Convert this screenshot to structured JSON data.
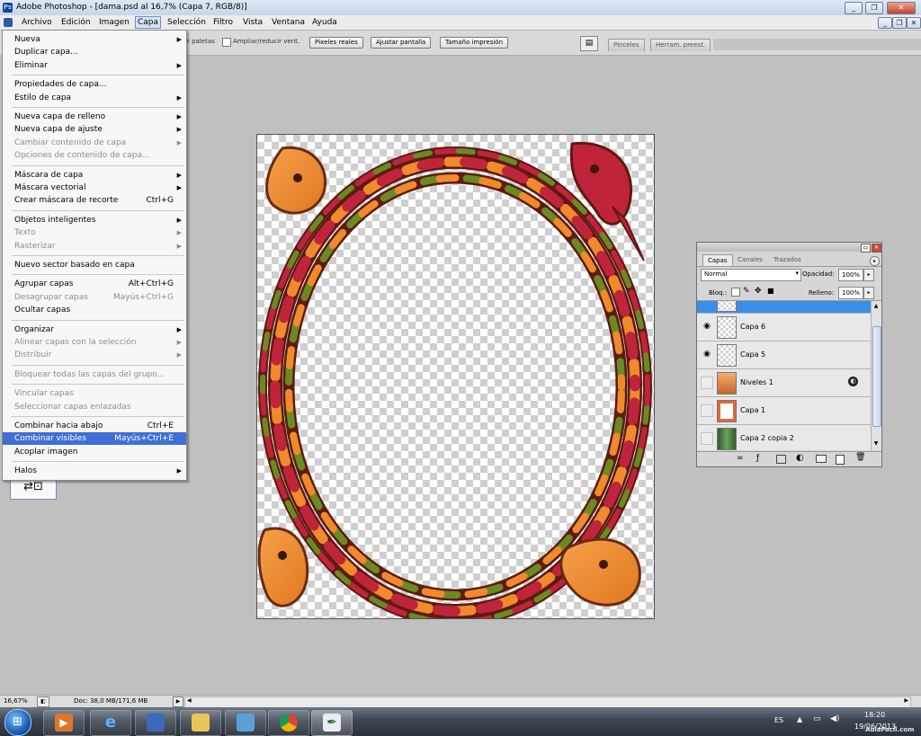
{
  "window": {
    "title": "Adobe Photoshop - [dama.psd al 16,7% (Capa 7, RGB/8)]",
    "buttons": [
      "_",
      "❐",
      "✕"
    ],
    "doc_buttons": [
      "_",
      "❐",
      "✕"
    ]
  },
  "menubar": {
    "items": [
      "Archivo",
      "Edición",
      "Imagen",
      "Capa",
      "Selección",
      "Filtro",
      "Vista",
      "Ventana",
      "Ayuda"
    ]
  },
  "options": {
    "partial_text": "r paletas",
    "resize_label": "Ampliar/reducir vent.",
    "buttons": [
      "Píxeles reales",
      "Ajustar pantalla",
      "Tamaño impresión"
    ],
    "palette_tabs": [
      "Pinceles",
      "Herram. preest."
    ]
  },
  "capa_menu": {
    "items": [
      {
        "label": "Nueva",
        "submenu": true,
        "disabled": false
      },
      {
        "label": "Duplicar capa...",
        "disabled": false
      },
      {
        "label": "Eliminar",
        "submenu": true,
        "disabled": false
      },
      {
        "sep": true
      },
      {
        "label": "Propiedades de capa...",
        "disabled": false
      },
      {
        "label": "Estilo de capa",
        "submenu": true,
        "disabled": false
      },
      {
        "sep": true
      },
      {
        "label": "Nueva capa de relleno",
        "submenu": true,
        "disabled": false
      },
      {
        "label": "Nueva capa de ajuste",
        "submenu": true,
        "disabled": false
      },
      {
        "label": "Cambiar contenido de capa",
        "submenu": true,
        "disabled": true
      },
      {
        "label": "Opciones de contenido de capa...",
        "disabled": true
      },
      {
        "sep": true
      },
      {
        "label": "Máscara de capa",
        "submenu": true,
        "disabled": false
      },
      {
        "label": "Máscara vectorial",
        "submenu": true,
        "disabled": false
      },
      {
        "label": "Crear máscara de recorte",
        "shortcut": "Ctrl+G",
        "disabled": false
      },
      {
        "sep": true
      },
      {
        "label": "Objetos inteligentes",
        "submenu": true,
        "disabled": false
      },
      {
        "label": "Texto",
        "submenu": true,
        "disabled": true
      },
      {
        "label": "Rasterizar",
        "submenu": true,
        "disabled": true
      },
      {
        "sep": true
      },
      {
        "label": "Nuevo sector basado en capa",
        "disabled": false
      },
      {
        "sep": true
      },
      {
        "label": "Agrupar capas",
        "shortcut": "Alt+Ctrl+G",
        "disabled": false
      },
      {
        "label": "Desagrupar capas",
        "shortcut": "Mayús+Ctrl+G",
        "disabled": true
      },
      {
        "label": "Ocultar capas",
        "disabled": false
      },
      {
        "sep": true
      },
      {
        "label": "Organizar",
        "submenu": true,
        "disabled": false
      },
      {
        "label": "Alinear capas con la selección",
        "submenu": true,
        "disabled": true
      },
      {
        "label": "Distribuir",
        "submenu": true,
        "disabled": true
      },
      {
        "sep": true
      },
      {
        "label": "Bloquear todas las capas del grupo...",
        "disabled": true
      },
      {
        "sep": true
      },
      {
        "label": "Vincular capas",
        "disabled": true
      },
      {
        "label": "Seleccionar capas enlazadas",
        "disabled": true
      },
      {
        "sep": true
      },
      {
        "label": "Combinar hacia abajo",
        "shortcut": "Ctrl+E",
        "disabled": false
      },
      {
        "label": "Combinar visibles",
        "shortcut": "Mayús+Ctrl+E",
        "disabled": false,
        "highlighted": true
      },
      {
        "label": "Acoplar imagen",
        "disabled": false
      },
      {
        "sep": true
      },
      {
        "label": "Halos",
        "submenu": true,
        "disabled": false
      }
    ]
  },
  "layers_panel": {
    "tabs": [
      "Capas",
      "Canales",
      "Trazados"
    ],
    "blend_mode": "Normal",
    "opacity_label": "Opacidad:",
    "opacity_value": "100%",
    "lock_label": "Bloq.:",
    "fill_label": "Relleno:",
    "fill_value": "100%",
    "layers": [
      {
        "name": "Capa 6",
        "visible": true
      },
      {
        "name": "Capa 5",
        "visible": true
      },
      {
        "name": "Niveles 1",
        "visible": false
      },
      {
        "name": "Capa 1",
        "visible": false
      },
      {
        "name": "Capa 2 copia 2",
        "visible": false
      }
    ],
    "bottom_icons": [
      "link-icon",
      "fx-icon",
      "mask-icon",
      "adjustment-icon",
      "folder-icon",
      "new-layer-icon",
      "trash-icon"
    ]
  },
  "statusbar": {
    "zoom": "16,67%",
    "doc_info": "Doc: 38,0 MB/171,6 MB"
  },
  "taskbar": {
    "lang": "ES",
    "time": "18:20",
    "date": "19/06/2013",
    "watermark": "AulaFacil.com"
  },
  "colors": {
    "menu_highlight": "#3f6fd6",
    "selected_layer": "#3a8ee8",
    "knot_orange": "#f08a2c",
    "knot_red": "#c0243a",
    "knot_green": "#6a8a22",
    "knot_outline": "#7a2a1a"
  }
}
